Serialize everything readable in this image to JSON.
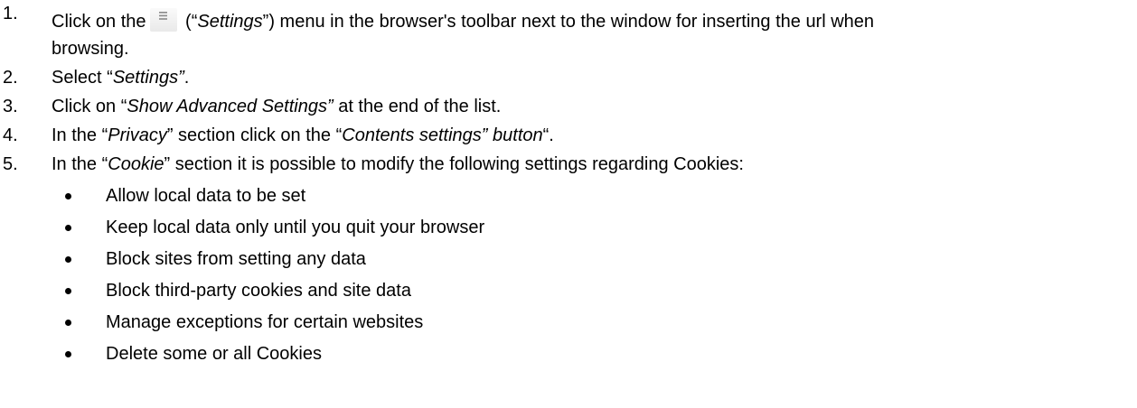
{
  "steps": [
    {
      "number": "1.",
      "before_icon": "Click on the",
      "icon": "hamburger-menu-icon",
      "after_icon_open": " (“",
      "italic": "Settings",
      "after_italic": "”) menu in the browser's toolbar next to the window for inserting the url when",
      "line2": "browsing."
    },
    {
      "number": "2.",
      "before": "Select “",
      "italic": "Settings”",
      "after": "."
    },
    {
      "number": "3.",
      "before": "Click on “",
      "italic": "Show Advanced Settings”",
      "after": " at the end of the list."
    },
    {
      "number": "4.",
      "before": "In the “",
      "italic1": "Privacy",
      "middle": "” section click on the “",
      "italic2": "Contents settings” button",
      "after": "“."
    },
    {
      "number": "5.",
      "before": "In the “",
      "italic": "Cookie",
      "after": "” section it is possible to modify the following settings regarding Cookies:"
    }
  ],
  "cookie_options": [
    "Allow local data to be set",
    "Keep local data only until you quit your browser",
    "Block sites from setting any data",
    "Block third-party cookies and site data",
    "Manage exceptions for certain websites",
    "Delete some or all Cookies"
  ],
  "colors": {
    "text": "#000000",
    "icon_bars": "#8a8a8a"
  }
}
